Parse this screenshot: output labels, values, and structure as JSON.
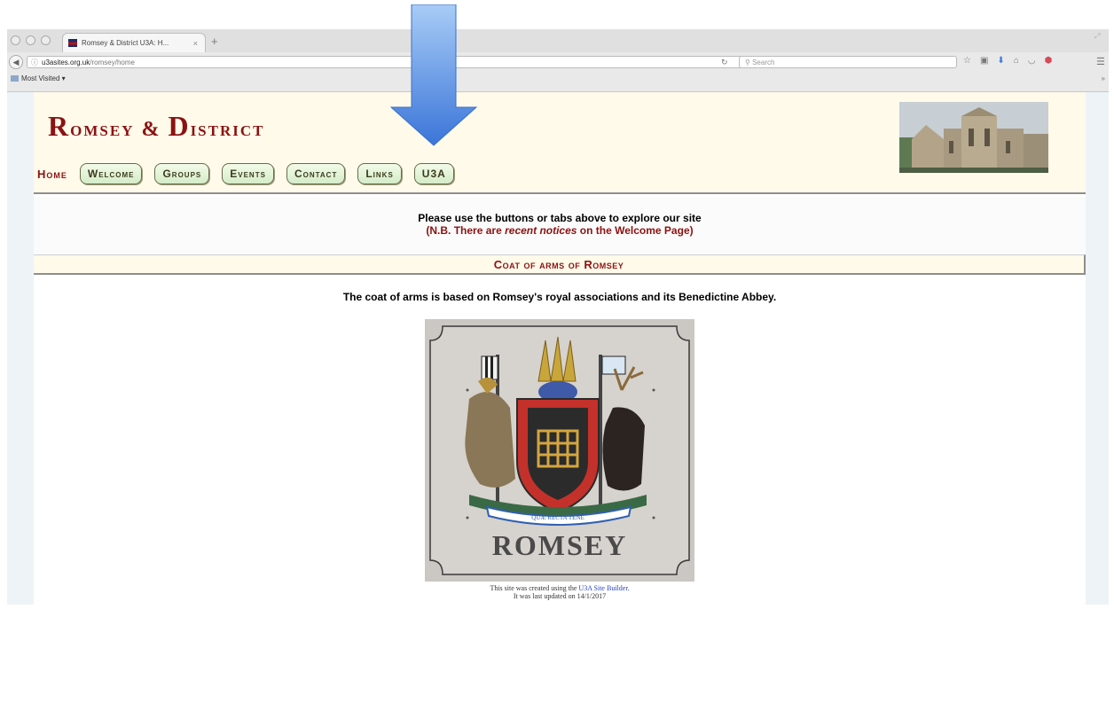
{
  "browser": {
    "tab_title": "Romsey & District U3A: H...",
    "tab_close": "×",
    "new_tab": "+",
    "url_host": "u3asites.org.uk",
    "url_path": "/romsey/home",
    "search_placeholder": "Search",
    "bookmarks_label": "Most Visited",
    "bookmarks_dropdown": "▾",
    "overflow": "»"
  },
  "site": {
    "title_initial1": "R",
    "title_rest1": "omsey",
    "title_amp": "&",
    "title_initial2": "D",
    "title_rest2": "istrict"
  },
  "nav": {
    "home": "Home",
    "buttons": [
      "Welcome",
      "Groups",
      "Events",
      "Contact",
      "Links",
      "U3A"
    ]
  },
  "intro": {
    "line1": "Please use the buttons or tabs above to explore our site",
    "line2_prefix": "(N.B. There are ",
    "line2_em": "recent notices",
    "line2_suffix": " on the Welcome Page)"
  },
  "section": {
    "heading": "Coat of arms of Romsey",
    "description": "The coat of arms is based on Romsey's royal associations and its Benedictine Abbey.",
    "motto": "QUÆ RECTA TENE",
    "plaque_text": "ROMSEY"
  },
  "footer": {
    "created_prefix": "This site was created using the ",
    "created_link": "U3A Site Builder.",
    "updated": "It was last updated on 14/1/2017"
  },
  "colors": {
    "maroon": "#8b1212",
    "cream": "#fffaea",
    "arrow_top": "#9ec3f5",
    "arrow_bottom": "#3b75d9"
  }
}
